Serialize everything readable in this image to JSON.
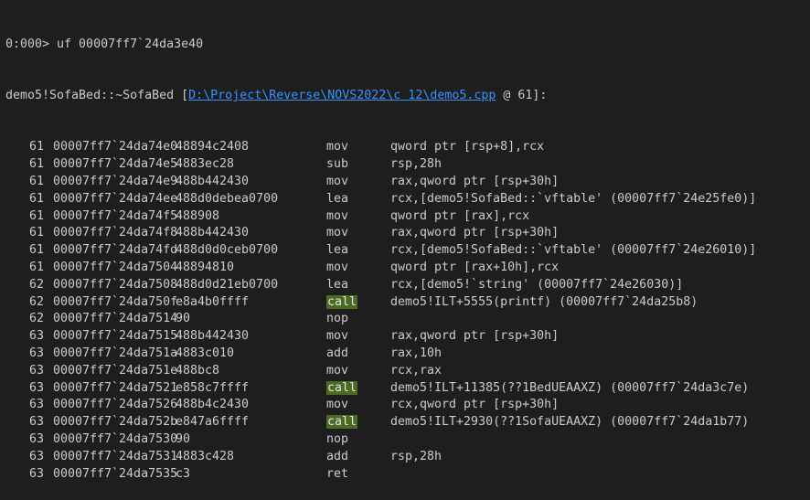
{
  "prompt_line": "0:000> uf 00007ff7`24da3e40",
  "header": {
    "symbol": "demo5!SofaBed::~SofaBed ",
    "bracket_open": "[",
    "path": "D:\\Project\\Reverse\\NOVS2022\\c 12\\demo5.cpp",
    "suffix": " @ 61]:"
  },
  "rows": [
    {
      "line": "61",
      "addr": "00007ff7`24da74e0",
      "bytes": "48894c2408",
      "mnem": "mov",
      "ops": "qword ptr [rsp+8],rcx",
      "hl": false
    },
    {
      "line": "61",
      "addr": "00007ff7`24da74e5",
      "bytes": "4883ec28",
      "mnem": "sub",
      "ops": "rsp,28h",
      "hl": false
    },
    {
      "line": "61",
      "addr": "00007ff7`24da74e9",
      "bytes": "488b442430",
      "mnem": "mov",
      "ops": "rax,qword ptr [rsp+30h]",
      "hl": false
    },
    {
      "line": "61",
      "addr": "00007ff7`24da74ee",
      "bytes": "488d0debea0700",
      "mnem": "lea",
      "ops": "rcx,[demo5!SofaBed::`vftable' (00007ff7`24e25fe0)]",
      "hl": false
    },
    {
      "line": "61",
      "addr": "00007ff7`24da74f5",
      "bytes": "488908",
      "mnem": "mov",
      "ops": "qword ptr [rax],rcx",
      "hl": false
    },
    {
      "line": "61",
      "addr": "00007ff7`24da74f8",
      "bytes": "488b442430",
      "mnem": "mov",
      "ops": "rax,qword ptr [rsp+30h]",
      "hl": false
    },
    {
      "line": "61",
      "addr": "00007ff7`24da74fd",
      "bytes": "488d0d0ceb0700",
      "mnem": "lea",
      "ops": "rcx,[demo5!SofaBed::`vftable' (00007ff7`24e26010)]",
      "hl": false
    },
    {
      "line": "61",
      "addr": "00007ff7`24da7504",
      "bytes": "48894810",
      "mnem": "mov",
      "ops": "qword ptr [rax+10h],rcx",
      "hl": false
    },
    {
      "line": "62",
      "addr": "00007ff7`24da7508",
      "bytes": "488d0d21eb0700",
      "mnem": "lea",
      "ops": "rcx,[demo5!`string' (00007ff7`24e26030)]",
      "hl": false
    },
    {
      "line": "62",
      "addr": "00007ff7`24da750f",
      "bytes": "e8a4b0ffff",
      "mnem": "call",
      "ops": "demo5!ILT+5555(printf) (00007ff7`24da25b8)",
      "hl": true
    },
    {
      "line": "62",
      "addr": "00007ff7`24da7514",
      "bytes": "90",
      "mnem": "nop",
      "ops": "",
      "hl": false
    },
    {
      "line": "63",
      "addr": "00007ff7`24da7515",
      "bytes": "488b442430",
      "mnem": "mov",
      "ops": "rax,qword ptr [rsp+30h]",
      "hl": false
    },
    {
      "line": "63",
      "addr": "00007ff7`24da751a",
      "bytes": "4883c010",
      "mnem": "add",
      "ops": "rax,10h",
      "hl": false
    },
    {
      "line": "63",
      "addr": "00007ff7`24da751e",
      "bytes": "488bc8",
      "mnem": "mov",
      "ops": "rcx,rax",
      "hl": false
    },
    {
      "line": "63",
      "addr": "00007ff7`24da7521",
      "bytes": "e858c7ffff",
      "mnem": "call",
      "ops": "demo5!ILT+11385(??1BedUEAAXZ) (00007ff7`24da3c7e)",
      "hl": true
    },
    {
      "line": "63",
      "addr": "00007ff7`24da7526",
      "bytes": "488b4c2430",
      "mnem": "mov",
      "ops": "rcx,qword ptr [rsp+30h]",
      "hl": false
    },
    {
      "line": "63",
      "addr": "00007ff7`24da752b",
      "bytes": "e847a6ffff",
      "mnem": "call",
      "ops": "demo5!ILT+2930(??1SofaUEAAXZ) (00007ff7`24da1b77)",
      "hl": true
    },
    {
      "line": "63",
      "addr": "00007ff7`24da7530",
      "bytes": "90",
      "mnem": "nop",
      "ops": "",
      "hl": false
    },
    {
      "line": "63",
      "addr": "00007ff7`24da7531",
      "bytes": "4883c428",
      "mnem": "add",
      "ops": "rsp,28h",
      "hl": false
    },
    {
      "line": "63",
      "addr": "00007ff7`24da7535",
      "bytes": "c3",
      "mnem": "ret",
      "ops": "",
      "hl": false
    }
  ],
  "colors": {
    "background": "#1e1e1e",
    "text": "#cccccc",
    "link": "#3794ff",
    "call_highlight": "#4b6a22"
  }
}
